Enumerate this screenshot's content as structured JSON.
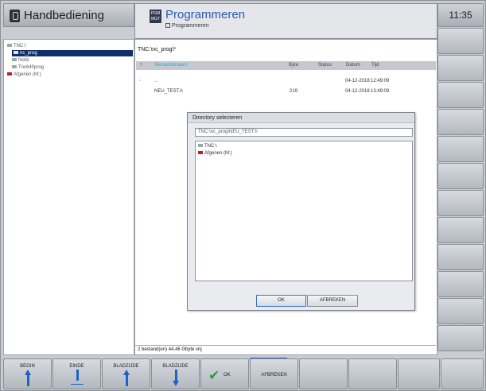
{
  "header": {
    "mode_title": "Handbediening",
    "app_title": "Programmeren",
    "app_subtitle": "Programmeren",
    "clock": "11:35",
    "prog_icon_text": "PGM MGT"
  },
  "tree": {
    "items": [
      {
        "label": "TNC:\\",
        "selected": false
      },
      {
        "label": "nc_prog",
        "selected": true
      },
      {
        "label": "Notiz",
        "selected": false
      },
      {
        "label": "Tnc640prog",
        "selected": false
      },
      {
        "label": "Afgenen (M:)",
        "selected": false
      }
    ]
  },
  "file_list": {
    "path": "TNC:\\nc_prog\\*",
    "columns": {
      "name": "Bestandsnaam",
      "size": "Byte",
      "status": "Status",
      "date": "Datum",
      "time": "Tijd"
    },
    "rows": [
      {
        "name": "..",
        "size": "",
        "status": "",
        "date": "04-12-2018",
        "time": "12:49:09"
      },
      {
        "name": "NEU_TEST.h",
        "size": "219",
        "status": "",
        "date": "04-12-2018",
        "time": "13:49:09"
      }
    ],
    "status_bar": "2 bestand(en) 44.46 Gbyte vrij"
  },
  "dialog": {
    "title": "Directory selecteren",
    "path_value": "TNC:\\nc_prog\\NEU_TEST.h",
    "nodes": [
      "TNC:\\",
      "Afgenen (M:)"
    ],
    "ok_label": "OK",
    "cancel_label": "AFBREKEN"
  },
  "softkeys": {
    "begin": "BEGIN",
    "begin_sub": "",
    "einde": "EINDE",
    "page_up": "BLADZIJDE",
    "page_down": "BLADZIJDE",
    "ok": "OK",
    "cancel": "AFBREKEN"
  },
  "colors": {
    "selection": "#102e6b",
    "accent_blue": "#2a57b8",
    "folder_red": "#b52323",
    "ok_green": "#2a9d35",
    "arrow_blue": "#1c63c6"
  },
  "icons": [
    "mode-icon",
    "pgm-mgt-icon",
    "folder-icon",
    "arrow-up-icon",
    "arrow-down-icon",
    "check-icon"
  ]
}
